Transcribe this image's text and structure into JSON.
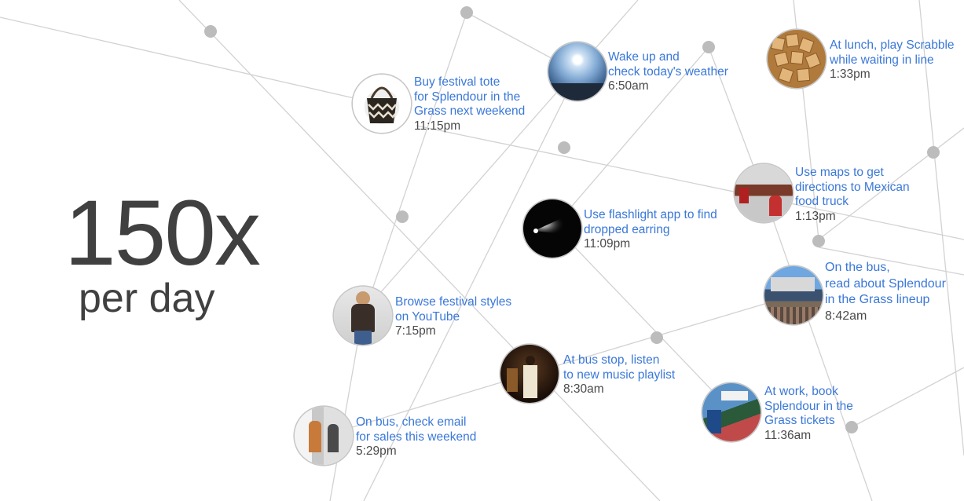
{
  "headline": {
    "number": "150x",
    "label": "per day"
  },
  "moments": [
    {
      "id": "tote",
      "lines": [
        "Buy festival tote",
        "for Splendour in the",
        "Grass next weekend"
      ],
      "time": "11:15pm",
      "image": "tote-bag-photo"
    },
    {
      "id": "weather",
      "lines": [
        "Wake up and",
        "check today's weather"
      ],
      "time": "6:50am",
      "image": "morning-sky-photo"
    },
    {
      "id": "scrabble",
      "lines": [
        "At lunch, play Scrabble",
        "while waiting in line"
      ],
      "time": "1:33pm",
      "image": "scrabble-tiles-photo"
    },
    {
      "id": "maps",
      "lines": [
        "Use maps to get",
        "directions to Mexican",
        "food truck"
      ],
      "time": "1:13pm",
      "image": "food-truck-photo"
    },
    {
      "id": "flashlight",
      "lines": [
        "Use flashlight app to find",
        "dropped earring"
      ],
      "time": "11:09pm",
      "image": "flashlight-beam-photo"
    },
    {
      "id": "lineup",
      "lines": [
        "On the bus,",
        "read about Splendour",
        "in the Grass lineup"
      ],
      "time": "8:42am",
      "image": "festival-stage-photo"
    },
    {
      "id": "youtube",
      "lines": [
        "Browse festival styles",
        "on YouTube"
      ],
      "time": "7:15pm",
      "image": "festival-outfit-photo"
    },
    {
      "id": "playlist",
      "lines": [
        "At bus stop, listen",
        "to new music playlist"
      ],
      "time": "8:30am",
      "image": "band-performance-photo"
    },
    {
      "id": "tickets",
      "lines": [
        "At work, book",
        "Splendour in the",
        "Grass tickets"
      ],
      "time": "11:36am",
      "image": "festival-sign-photo"
    },
    {
      "id": "email",
      "lines": [
        "On bus, check email",
        "for sales this weekend"
      ],
      "time": "5:29pm",
      "image": "shopping-street-photo"
    }
  ],
  "colors": {
    "link": "#3a78d8",
    "time": "#4a4a4a",
    "headline": "#404040",
    "edge": "#d2d2d2",
    "dot": "#bcbcbc"
  }
}
